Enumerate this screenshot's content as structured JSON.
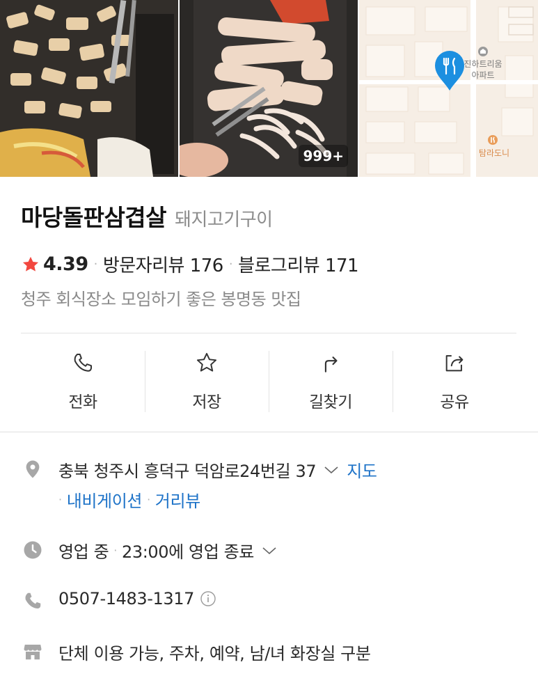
{
  "gallery": {
    "photo_count_badge": "999+",
    "map": {
      "labels": [
        "진하트리움",
        "아파트",
        "탐라도니"
      ],
      "pin_color": "#1c8fe0",
      "poi_color": "#e99d5a"
    }
  },
  "place": {
    "name": "마당돌판삼겹살",
    "category": "돼지고기구이",
    "rating": "4.39",
    "visitor_reviews": "방문자리뷰 176",
    "blog_reviews": "블로그리뷰 171",
    "description": "청주 회식장소 모임하기 좋은 봉명동 맛집"
  },
  "actions": [
    {
      "label": "전화",
      "icon": "phone-icon"
    },
    {
      "label": "저장",
      "icon": "star-outline-icon"
    },
    {
      "label": "길찾기",
      "icon": "directions-icon"
    },
    {
      "label": "공유",
      "icon": "share-icon"
    }
  ],
  "info": {
    "address": "충북 청주시 흥덕구 덕암로24번길 37",
    "map_link": "지도",
    "navigation_link": "내비게이션",
    "street_view_link": "거리뷰",
    "hours_status": "영업 중",
    "hours_detail": "23:00에 영업 종료",
    "phone": "0507-1483-1317",
    "amenities": "단체 이용 가능, 주차, 예약, 남/녀 화장실 구분"
  },
  "colors": {
    "accent_star": "#f2473f",
    "link": "#1e73c8",
    "muted_text": "#8a8a8a",
    "icon_gray": "#a7a7a7"
  }
}
